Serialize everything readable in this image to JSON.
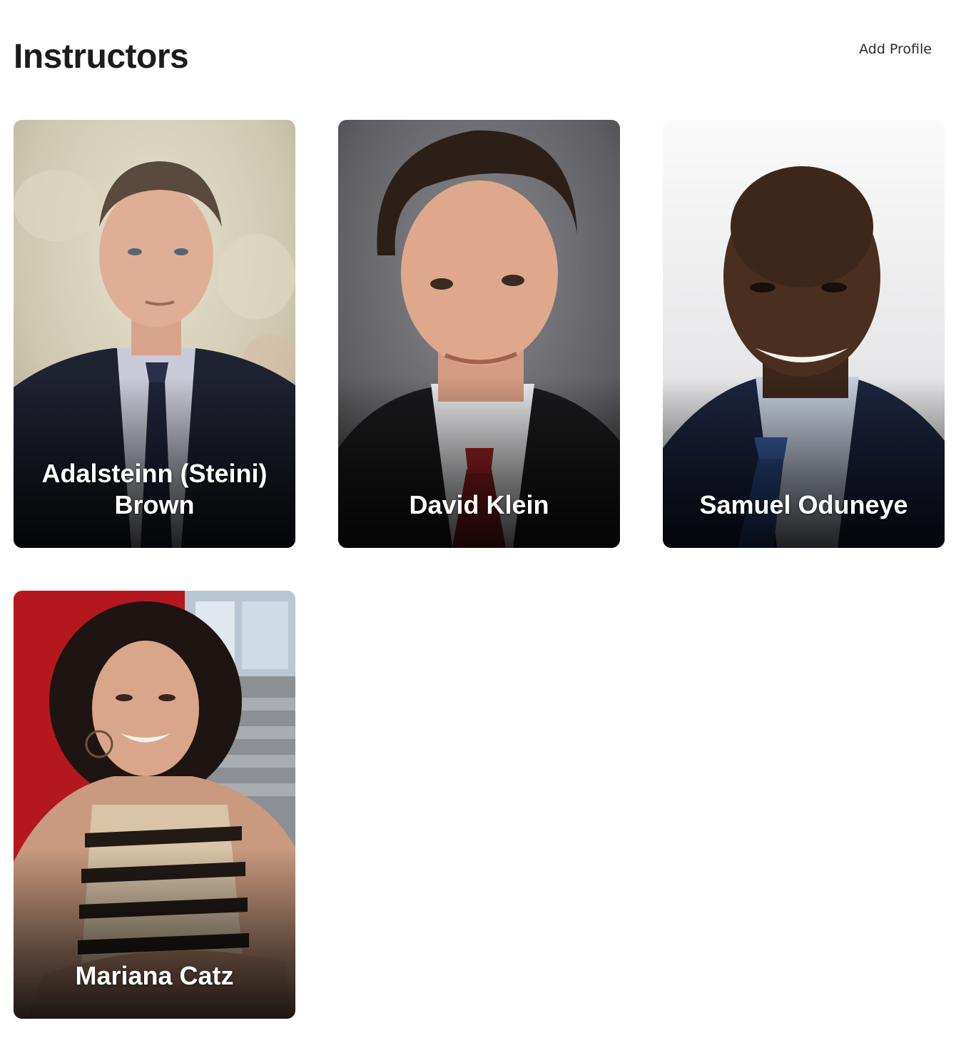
{
  "header": {
    "title": "Instructors",
    "add_profile_label": "Add Profile"
  },
  "instructors": [
    {
      "name": "Adalsteinn (Steini) Brown"
    },
    {
      "name": "David Klein"
    },
    {
      "name": "Samuel Oduneye"
    },
    {
      "name": "Mariana Catz"
    }
  ],
  "colors": {
    "background": "#ffffff",
    "title": "#1c1c1c",
    "card_name": "#ffffff",
    "card4_backdrop": "#b5171e"
  }
}
